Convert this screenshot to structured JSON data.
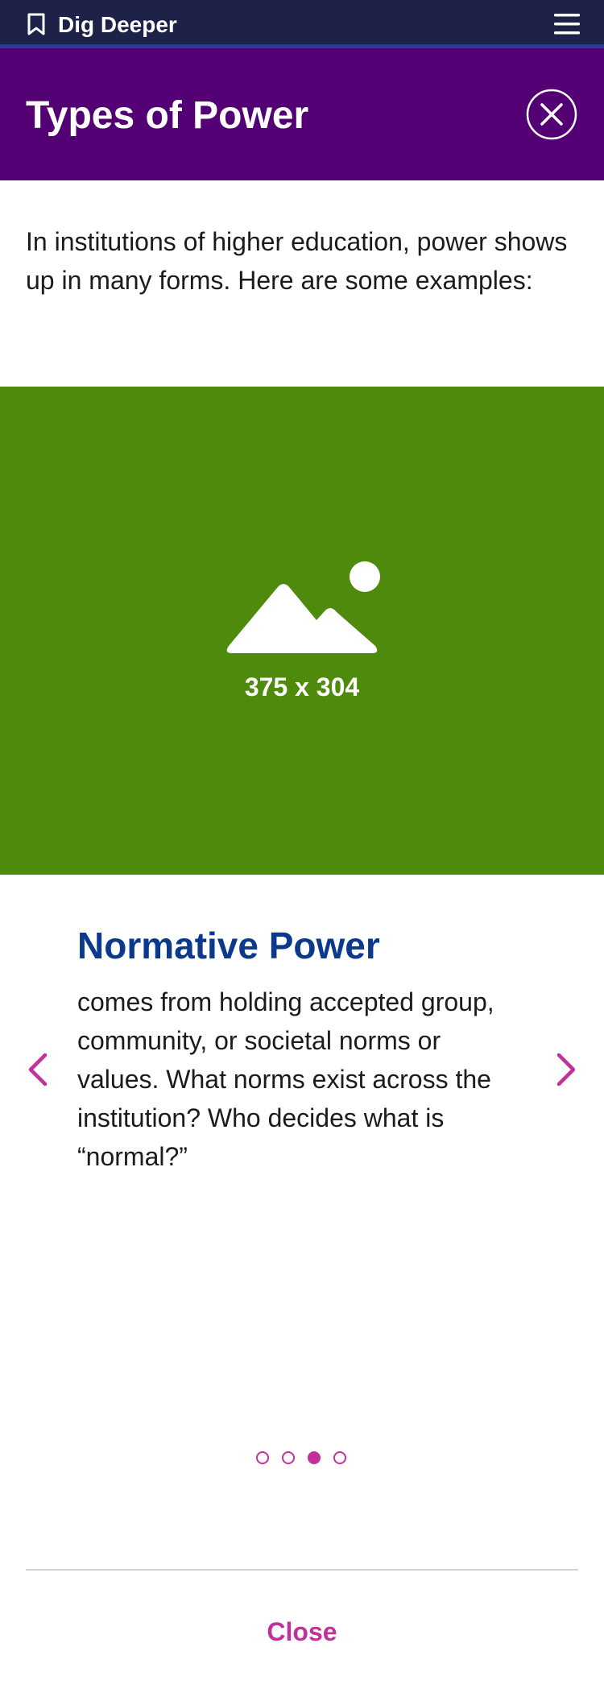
{
  "topbar": {
    "brand": "Dig Deeper",
    "bookmark_icon": "bookmark-icon",
    "menu_icon": "hamburger-menu-icon",
    "background_color": "#1e2148"
  },
  "header": {
    "title": "Types of Power",
    "close_icon": "close-circle-icon",
    "background_color": "#530075"
  },
  "intro": {
    "text": "In institutions of higher education, power shows up in many forms. Here are some examples:"
  },
  "image": {
    "placeholder_label": "375 x 304",
    "icon": "image-placeholder-icon",
    "background_color": "#4e8a0b"
  },
  "carousel": {
    "slide_title": "Normative Power",
    "slide_body": "comes from holding accepted group, community, or societal norms or values. What norms exist across the institution? Who decides what is “normal?”",
    "prev_icon": "chevron-left-icon",
    "next_icon": "chevron-right-icon",
    "total_slides": 4,
    "active_slide": 3,
    "accent_color": "#c2309a"
  },
  "footer": {
    "close_label": "Close"
  }
}
